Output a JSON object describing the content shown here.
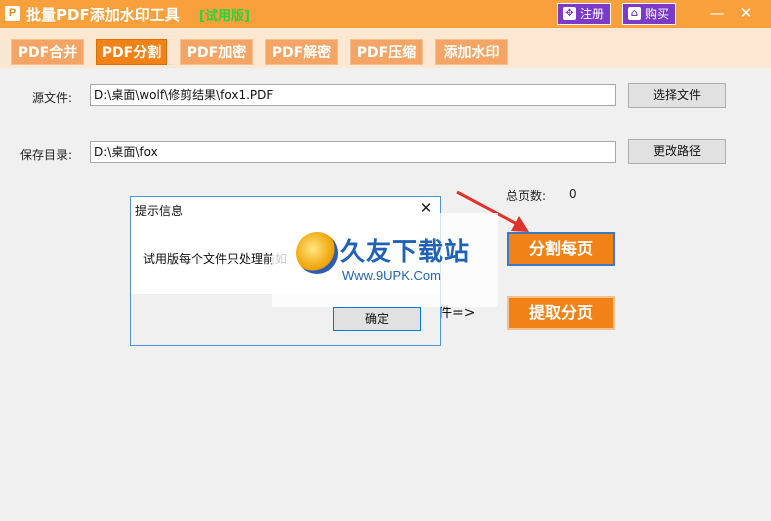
{
  "titlebar": {
    "title": "批量PDF添加水印工具",
    "trial_tag": "[试用版]",
    "register_label": "注册",
    "buy_label": "购买",
    "minimize_glyph": "—",
    "close_glyph": "✕"
  },
  "tabs": [
    {
      "label": "PDF合并",
      "active": false
    },
    {
      "label": "PDF分割",
      "active": true
    },
    {
      "label": "PDF加密",
      "active": false
    },
    {
      "label": "PDF解密",
      "active": false
    },
    {
      "label": "PDF压缩",
      "active": false
    },
    {
      "label": "添加水印",
      "active": false
    }
  ],
  "source": {
    "label": "源文件:",
    "value": "D:\\桌面\\wolf\\修剪结果\\fox1.PDF",
    "button": "选择文件"
  },
  "save": {
    "label": "保存目录:",
    "value": "D:\\桌面\\fox",
    "button": "更改路径"
  },
  "page_count": {
    "label": "总页数:",
    "value": "0"
  },
  "actions": {
    "split_each": "分割每页",
    "extract": "提取分页",
    "partial_text": "件=>"
  },
  "dialog": {
    "title": "提示信息",
    "message": "试用版每个文件只处理前如",
    "ok": "确定"
  },
  "watermark": {
    "title": "久友下载站",
    "url": "Www.9UPK.Com"
  },
  "colors": {
    "accent": "#f08218",
    "titlebar": "#f7a03c",
    "register": "#7a3cc8",
    "trial": "#2bd33b",
    "dialog_border": "#4d94d6",
    "arrow": "#e0322c"
  }
}
